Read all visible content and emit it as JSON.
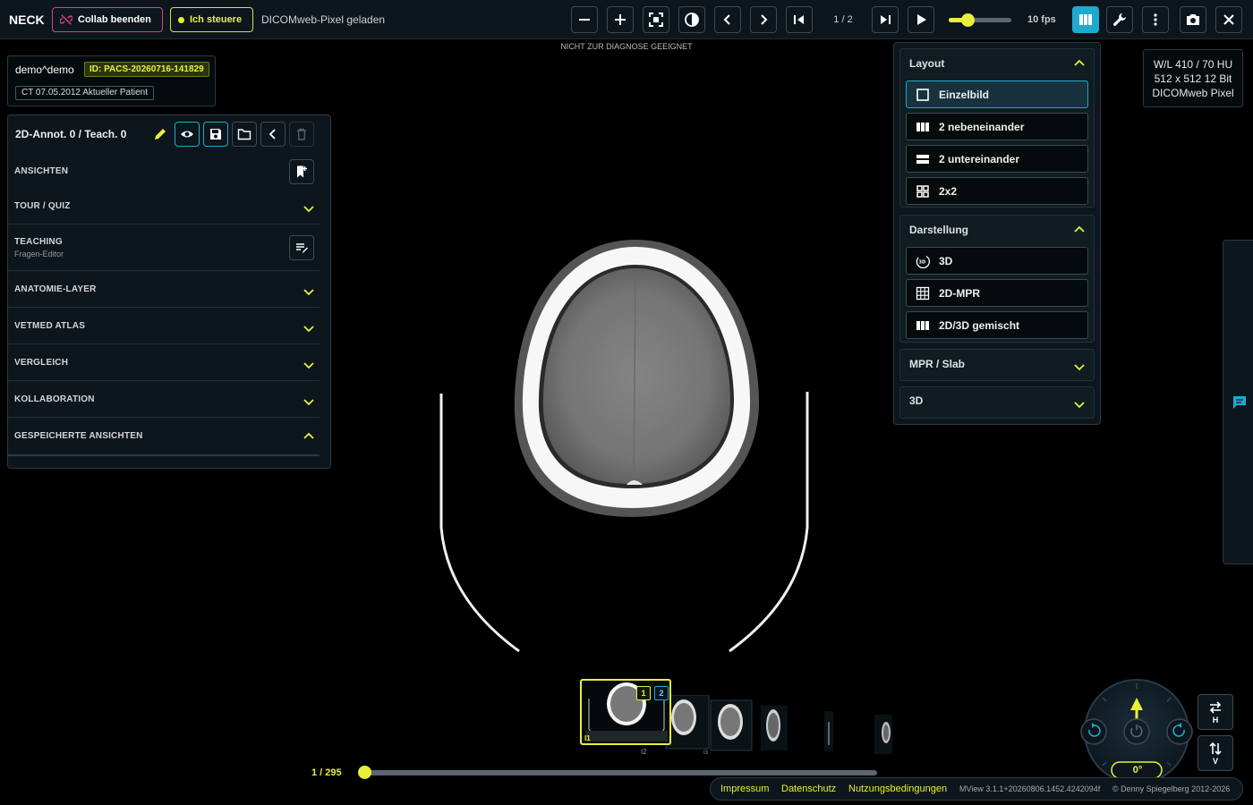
{
  "topbar": {
    "brand": "NECK",
    "collab_label": "Collab beenden",
    "steer_label": "Ich steuere",
    "status": "DICOMweb-Pixel geladen",
    "frame_counter": "1 / 2",
    "fps": "10 fps",
    "speed_fraction": 0.3,
    "buttons": [
      "zoom-out-icon",
      "zoom-in-icon",
      "fit-icon",
      "contrast-icon",
      "prev-icon",
      "next-icon",
      "first-icon",
      "last-icon",
      "play-icon",
      "layout-icon",
      "wrench-icon",
      "more-icon",
      "camera-icon",
      "close-icon"
    ]
  },
  "disclaimer": "NICHT ZUR DIAGNOSE GEEIGNET",
  "patient": {
    "name": "demo^demo",
    "id": "ID: PACS-20260716-141829",
    "study": "CT 07.05.2012 Aktueller Patient"
  },
  "left_panel": {
    "title": "2D-Annot. 0 / Teach. 0",
    "sections": {
      "ansichten": "ANSICHTEN",
      "tour": "TOUR / QUIZ",
      "teaching": "TEACHING",
      "teaching_sub": "Fragen-Editor",
      "anatomie": "ANATOMIE-LAYER",
      "vetmed": "VETMED ATLAS",
      "vergleich": "VERGLEICH",
      "kollaboration": "KOLLABORATION",
      "gespeichert": "GESPEICHERTE ANSICHTEN"
    }
  },
  "right_panel": {
    "layout_title": "Layout",
    "layout_options": [
      "Einzelbild",
      "2 nebeneinander",
      "2 untereinander",
      "2x2"
    ],
    "display_title": "Darstellung",
    "display_options": [
      "3D",
      "2D-MPR",
      "2D/3D gemischt"
    ],
    "mpr_title": "MPR / Slab",
    "threed_title": "3D"
  },
  "wl": {
    "line1": "W/L 410 / 70 HU",
    "line2": "512 x 512 12 Bit",
    "line3": "DICOMweb Pixel"
  },
  "thumbnails": {
    "badge1": "1",
    "badge2": "2",
    "label_sel": "I1",
    "label_2": "I2",
    "label_3": "I3"
  },
  "timeline": {
    "counter": "1 / 295",
    "position_fraction": 0.0
  },
  "compass": {
    "angle": "0°",
    "flip_h": "H",
    "flip_v": "V"
  },
  "footer": {
    "impressum": "Impressum",
    "datenschutz": "Datenschutz",
    "nutzung": "Nutzungsbedingungen",
    "version": "MView 3.1.1+20260806.1452.4242094f",
    "copyright": "© Denny Spiegelberg 2012-2026"
  },
  "colors": {
    "accent_yellow": "#e8f03c",
    "accent_blue": "#20a9cf",
    "collab_pink": "#e23d8a",
    "panel_bg": "#0d161d"
  }
}
